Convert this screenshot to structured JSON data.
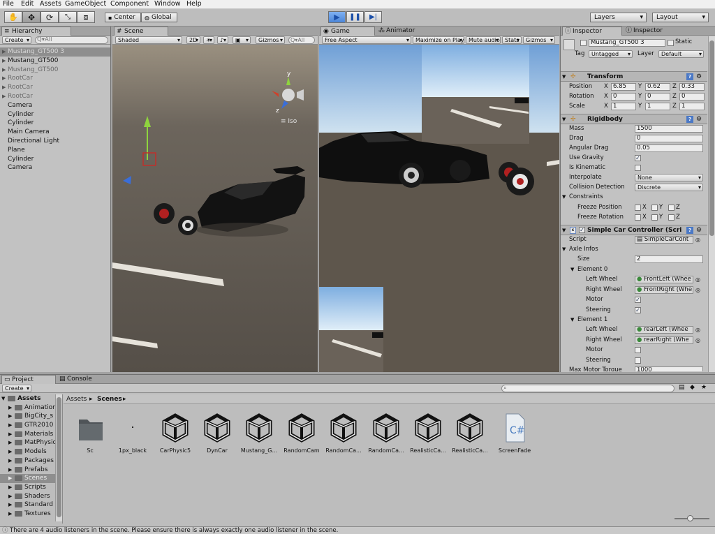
{
  "menu": [
    "File",
    "Edit",
    "Assets",
    "GameObject",
    "Component",
    "Window",
    "Help"
  ],
  "toolbar": {
    "center": "Center",
    "global": "Global",
    "layers": "Layers",
    "layout": "Layout"
  },
  "hierarchy": {
    "tab": "Hierarchy",
    "create": "Create",
    "search_placeholder": "Q▾All",
    "items": [
      {
        "label": "Mustang_GT500 3",
        "state": "selected",
        "arrow": true
      },
      {
        "label": "Mustang_GT500",
        "state": "normal",
        "arrow": true
      },
      {
        "label": "Mustang_GT500",
        "state": "dim",
        "arrow": true
      },
      {
        "label": "RootCar",
        "state": "dim",
        "arrow": true
      },
      {
        "label": "RootCar",
        "state": "dim",
        "arrow": true
      },
      {
        "label": "RootCar",
        "state": "dim",
        "arrow": true
      },
      {
        "label": "Camera",
        "state": "normal",
        "arrow": false
      },
      {
        "label": "Cylinder",
        "state": "normal",
        "arrow": false
      },
      {
        "label": "Cylinder",
        "state": "normal",
        "arrow": false
      },
      {
        "label": "Main Camera",
        "state": "normal",
        "arrow": false
      },
      {
        "label": "Directional Light",
        "state": "normal",
        "arrow": false
      },
      {
        "label": "Plane",
        "state": "normal",
        "arrow": false
      },
      {
        "label": "Cylinder",
        "state": "normal",
        "arrow": false
      },
      {
        "label": "Camera",
        "state": "normal",
        "arrow": false
      }
    ]
  },
  "scene": {
    "tab": "Scene",
    "shaded": "Shaded",
    "mode2d": "2D",
    "gizmos": "Gizmos",
    "search": "Q▾All",
    "iso": "Iso",
    "axis_y": "y",
    "axis_z": "z"
  },
  "game": {
    "tab": "Game",
    "animator_tab": "Animator",
    "aspect": "Free Aspect",
    "maximize": "Maximize on Play",
    "mute": "Mute audio",
    "stats": "Stats",
    "gizmos": "Gizmos"
  },
  "inspector": {
    "tab": "Inspector",
    "tab2": "Inspector",
    "object_name": "Mustang_GT500 3",
    "static": "Static",
    "tag_label": "Tag",
    "tag": "Untagged",
    "layer_label": "Layer",
    "layer": "Default",
    "transform": {
      "title": "Transform",
      "position_label": "Position",
      "px": "6.85",
      "py": "0.62",
      "pz": "0.33",
      "rotation_label": "Rotation",
      "rx": "0",
      "ry": "0",
      "rz": "0",
      "scale_label": "Scale",
      "sx": "1",
      "sy": "1",
      "sz": "1",
      "x": "X",
      "y": "Y",
      "z": "Z"
    },
    "rigidbody": {
      "title": "Rigidbody",
      "mass_label": "Mass",
      "mass": "1500",
      "drag_label": "Drag",
      "drag": "0",
      "angular_label": "Angular Drag",
      "angular": "0.05",
      "gravity_label": "Use Gravity",
      "kinematic_label": "Is Kinematic",
      "interp_label": "Interpolate",
      "interp": "None",
      "collision_label": "Collision Detection",
      "collision": "Discrete",
      "constraints_label": "Constraints",
      "freeze_pos_label": "Freeze Position",
      "freeze_rot_label": "Freeze Rotation"
    },
    "script": {
      "title": "Simple Car Controller (Scri",
      "script_label": "Script",
      "script": "SimpleCarCont",
      "axle_label": "Axle Infos",
      "size_label": "Size",
      "size": "2",
      "el0": "Element 0",
      "el1": "Element 1",
      "left_label": "Left Wheel",
      "right_label": "Right Wheel",
      "motor_label": "Motor",
      "steering_label": "Steering",
      "fl": "FrontLeft (Whee",
      "fr": "FrontRight (Whe",
      "rl": "rearLeft (Whee",
      "rr": "rearRight (Whe",
      "max_motor_label": "Max Motor Torque",
      "max_motor": "1000"
    }
  },
  "project": {
    "tab": "Project",
    "console_tab": "Console",
    "create": "Create",
    "breadcrumb_root": "Assets",
    "breadcrumb_current": "Scenes",
    "tree": [
      {
        "label": "Assets",
        "bold": true,
        "indent": 0
      },
      {
        "label": "Animation",
        "indent": 1
      },
      {
        "label": "BigCity_s",
        "indent": 1
      },
      {
        "label": "GTR2010",
        "indent": 1
      },
      {
        "label": "Materials",
        "indent": 1
      },
      {
        "label": "MatPhysic",
        "indent": 1
      },
      {
        "label": "Models",
        "indent": 1
      },
      {
        "label": "Packages",
        "indent": 1
      },
      {
        "label": "Prefabs",
        "indent": 1
      },
      {
        "label": "Scenes",
        "indent": 1,
        "selected": true
      },
      {
        "label": "Scripts",
        "indent": 1
      },
      {
        "label": "Shaders",
        "indent": 1
      },
      {
        "label": "Standard",
        "indent": 1
      },
      {
        "label": "Textures",
        "indent": 1
      }
    ],
    "assets": [
      {
        "label": "Sc",
        "kind": "folder"
      },
      {
        "label": "1px_black",
        "kind": "dot"
      },
      {
        "label": "CarPhysic5",
        "kind": "unity"
      },
      {
        "label": "DynCar",
        "kind": "unity"
      },
      {
        "label": "Mustang_G...",
        "kind": "unity"
      },
      {
        "label": "RandomCam",
        "kind": "unity"
      },
      {
        "label": "RandomCa...",
        "kind": "unity"
      },
      {
        "label": "RandomCa...",
        "kind": "unity"
      },
      {
        "label": "RealisticCa...",
        "kind": "unity"
      },
      {
        "label": "RealisticCa...",
        "kind": "unity"
      },
      {
        "label": "ScreenFade",
        "kind": "cs"
      }
    ],
    "cs_icon": "C#"
  },
  "status": "There are 4 audio listeners in the scene. Please ensure there is always exactly one audio listener in the scene.",
  "colors": {
    "accent": "#3c78d8",
    "selection": "#8e8e8e"
  }
}
